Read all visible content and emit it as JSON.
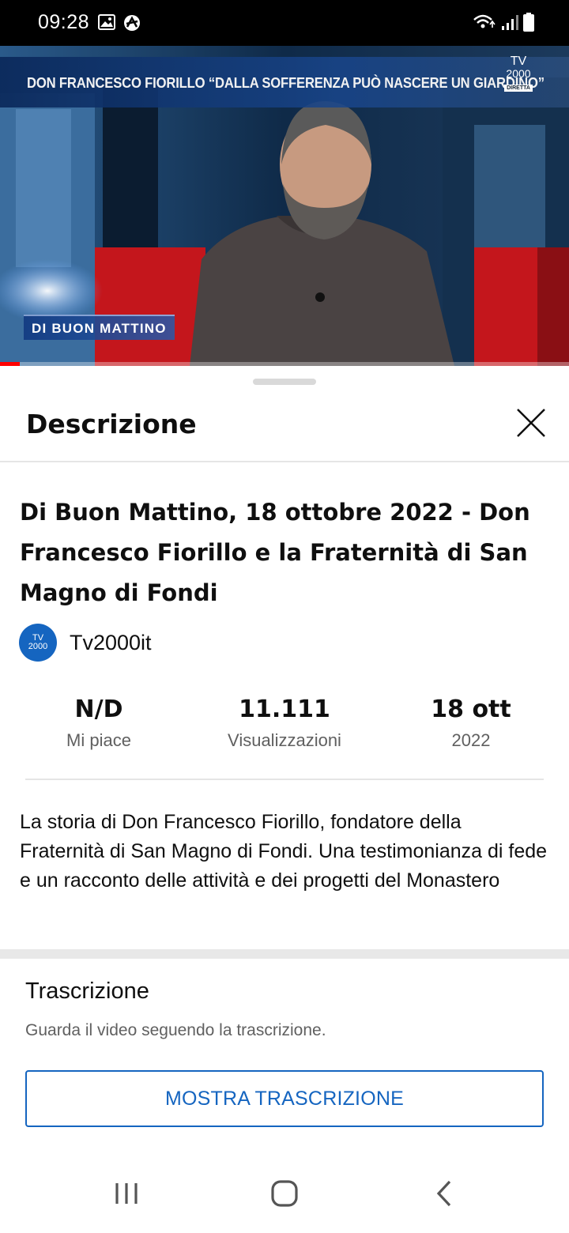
{
  "status_bar": {
    "time": "09:28",
    "icons": [
      "gallery-icon",
      "vpn-icon",
      "wifi-icon",
      "signal-icon",
      "battery-icon"
    ]
  },
  "video": {
    "banner_text": "DON FRANCESCO FIORILLO “DALLA SOFFERENZA PUÒ NASCERE UN GIARDINO”",
    "logo_tv": "TV",
    "logo_num": "2000",
    "logo_live": "DIRETTA",
    "show_label": "DI BUON MATTINO",
    "progress": 0.035,
    "progress_color": "#ff0000"
  },
  "sheet": {
    "title": "Descrizione",
    "close_icon": "close-icon",
    "video_title": "Di Buon Mattino, 18 ottobre 2022 - Don Francesco Fiorillo e la Fraternità di San Magno di Fondi",
    "channel": {
      "avatar_line1": "TV",
      "avatar_line2": "2000",
      "name": "Tv2000it"
    },
    "stats": [
      {
        "value": "N/D",
        "label": "Mi piace"
      },
      {
        "value": "11.111",
        "label": "Visualizzazioni"
      },
      {
        "value": "18 ott",
        "label": "2022"
      }
    ],
    "description": "La storia di Don Francesco Fiorillo, fondatore della Fraternità di San Magno di Fondi. Una testimonianza di fede e un racconto delle attività e dei progetti del Monastero",
    "transcript": {
      "title": "Trascrizione",
      "subtitle": "Guarda il video seguendo la trascrizione.",
      "button": "MOSTRA TRASCRIZIONE"
    }
  },
  "nav_bar": {
    "icons": [
      "recent-apps-icon",
      "home-icon",
      "back-icon"
    ]
  },
  "colors": {
    "accent": "#1565c0",
    "text_primary": "#0f0f0f",
    "text_secondary": "#606060",
    "progress": "#ff0000"
  }
}
